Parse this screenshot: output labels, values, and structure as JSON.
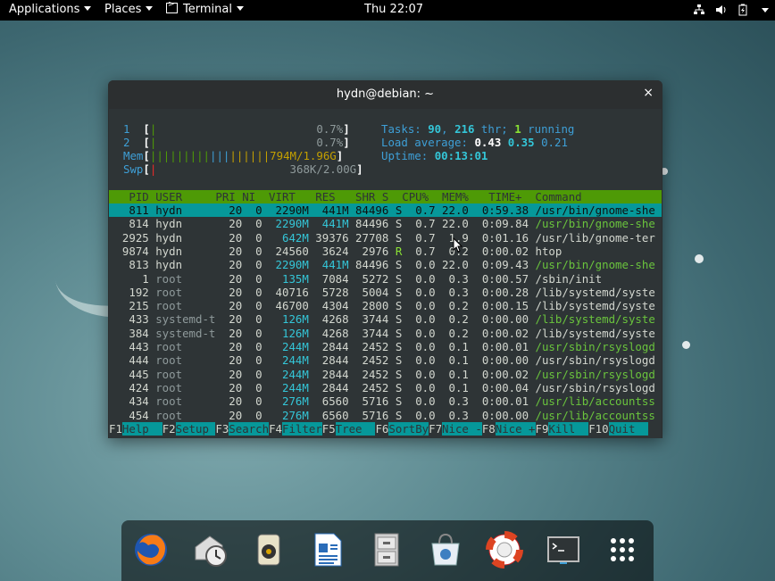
{
  "topbar": {
    "applications": "Applications",
    "places": "Places",
    "terminal": "Terminal",
    "clock": "Thu 22:07",
    "icons": [
      "network-icon",
      "volume-icon",
      "battery-icon",
      "power-menu-icon"
    ]
  },
  "window": {
    "title": "hydn@debian: ~",
    "close": "×"
  },
  "htop": {
    "cpu1": {
      "label": "1",
      "percent": "0.7%"
    },
    "cpu2": {
      "label": "2",
      "percent": "0.7%"
    },
    "mem": {
      "label": "Mem",
      "value": "794M/1.96G"
    },
    "swp": {
      "label": "Swp",
      "value": "368K/2.00G"
    },
    "tasks_label": "Tasks: ",
    "tasks": "90",
    "threads": "216",
    "threads_label": " thr; ",
    "running": "1",
    "running_label": " running",
    "load_label": "Load average: ",
    "load1": "0.43",
    "load5": "0.35",
    "load15": "0.21",
    "uptime_label": "Uptime: ",
    "uptime": "00:13:01",
    "columns": [
      "PID",
      "USER",
      "PRI",
      "NI",
      "VIRT",
      "RES",
      "SHR",
      "S",
      "CPU%",
      "MEM%",
      "TIME+",
      "Command"
    ],
    "processes": [
      {
        "pid": "811",
        "user": "hydn",
        "pri": "20",
        "ni": "0",
        "virt": "2290M",
        "res": "441M",
        "shr": "84496",
        "s": "S",
        "cpu": "0.7",
        "mem": "22.0",
        "time": "0:59.38",
        "cmd": "/usr/bin/gnome-she"
      },
      {
        "pid": "814",
        "user": "hydn",
        "pri": "20",
        "ni": "0",
        "virt": "2290M",
        "res": "441M",
        "shr": "84496",
        "s": "S",
        "cpu": "0.7",
        "mem": "22.0",
        "time": "0:09.84",
        "cmd": "/usr/bin/gnome-she"
      },
      {
        "pid": "2925",
        "user": "hydn",
        "pri": "20",
        "ni": "0",
        "virt": "642M",
        "res": "39376",
        "shr": "27708",
        "s": "S",
        "cpu": "0.7",
        "mem": "1.9",
        "time": "0:01.16",
        "cmd": "/usr/lib/gnome-ter"
      },
      {
        "pid": "9874",
        "user": "hydn",
        "pri": "20",
        "ni": "0",
        "virt": "24560",
        "res": "3624",
        "shr": "2976",
        "s": "R",
        "cpu": "0.7",
        "mem": "0.2",
        "time": "0:00.02",
        "cmd": "htop"
      },
      {
        "pid": "813",
        "user": "hydn",
        "pri": "20",
        "ni": "0",
        "virt": "2290M",
        "res": "441M",
        "shr": "84496",
        "s": "S",
        "cpu": "0.0",
        "mem": "22.0",
        "time": "0:09.43",
        "cmd": "/usr/bin/gnome-she"
      },
      {
        "pid": "1",
        "user": "root",
        "pri": "20",
        "ni": "0",
        "virt": "135M",
        "res": "7084",
        "shr": "5272",
        "s": "S",
        "cpu": "0.0",
        "mem": "0.3",
        "time": "0:00.57",
        "cmd": "/sbin/init"
      },
      {
        "pid": "192",
        "user": "root",
        "pri": "20",
        "ni": "0",
        "virt": "40716",
        "res": "5728",
        "shr": "5004",
        "s": "S",
        "cpu": "0.0",
        "mem": "0.3",
        "time": "0:00.28",
        "cmd": "/lib/systemd/syste"
      },
      {
        "pid": "215",
        "user": "root",
        "pri": "20",
        "ni": "0",
        "virt": "46700",
        "res": "4304",
        "shr": "2800",
        "s": "S",
        "cpu": "0.0",
        "mem": "0.2",
        "time": "0:00.15",
        "cmd": "/lib/systemd/syste"
      },
      {
        "pid": "433",
        "user": "systemd-t",
        "pri": "20",
        "ni": "0",
        "virt": "126M",
        "res": "4268",
        "shr": "3744",
        "s": "S",
        "cpu": "0.0",
        "mem": "0.2",
        "time": "0:00.00",
        "cmd": "/lib/systemd/syste"
      },
      {
        "pid": "384",
        "user": "systemd-t",
        "pri": "20",
        "ni": "0",
        "virt": "126M",
        "res": "4268",
        "shr": "3744",
        "s": "S",
        "cpu": "0.0",
        "mem": "0.2",
        "time": "0:00.02",
        "cmd": "/lib/systemd/syste"
      },
      {
        "pid": "443",
        "user": "root",
        "pri": "20",
        "ni": "0",
        "virt": "244M",
        "res": "2844",
        "shr": "2452",
        "s": "S",
        "cpu": "0.0",
        "mem": "0.1",
        "time": "0:00.01",
        "cmd": "/usr/sbin/rsyslogd"
      },
      {
        "pid": "444",
        "user": "root",
        "pri": "20",
        "ni": "0",
        "virt": "244M",
        "res": "2844",
        "shr": "2452",
        "s": "S",
        "cpu": "0.0",
        "mem": "0.1",
        "time": "0:00.00",
        "cmd": "/usr/sbin/rsyslogd"
      },
      {
        "pid": "445",
        "user": "root",
        "pri": "20",
        "ni": "0",
        "virt": "244M",
        "res": "2844",
        "shr": "2452",
        "s": "S",
        "cpu": "0.0",
        "mem": "0.1",
        "time": "0:00.02",
        "cmd": "/usr/sbin/rsyslogd"
      },
      {
        "pid": "424",
        "user": "root",
        "pri": "20",
        "ni": "0",
        "virt": "244M",
        "res": "2844",
        "shr": "2452",
        "s": "S",
        "cpu": "0.0",
        "mem": "0.1",
        "time": "0:00.04",
        "cmd": "/usr/sbin/rsyslogd"
      },
      {
        "pid": "434",
        "user": "root",
        "pri": "20",
        "ni": "0",
        "virt": "276M",
        "res": "6560",
        "shr": "5716",
        "s": "S",
        "cpu": "0.0",
        "mem": "0.3",
        "time": "0:00.01",
        "cmd": "/usr/lib/accountss"
      },
      {
        "pid": "454",
        "user": "root",
        "pri": "20",
        "ni": "0",
        "virt": "276M",
        "res": "6560",
        "shr": "5716",
        "s": "S",
        "cpu": "0.0",
        "mem": "0.3",
        "time": "0:00.00",
        "cmd": "/usr/lib/accountss"
      }
    ],
    "fkeys": [
      {
        "key": "F1",
        "label": "Help  "
      },
      {
        "key": "F2",
        "label": "Setup "
      },
      {
        "key": "F3",
        "label": "Search"
      },
      {
        "key": "F4",
        "label": "Filter"
      },
      {
        "key": "F5",
        "label": "Tree  "
      },
      {
        "key": "F6",
        "label": "SortBy"
      },
      {
        "key": "F7",
        "label": "Nice -"
      },
      {
        "key": "F8",
        "label": "Nice +"
      },
      {
        "key": "F9",
        "label": "Kill  "
      },
      {
        "key": "F10",
        "label": "Quit  "
      }
    ]
  },
  "dock": {
    "apps": [
      "firefox-icon",
      "evolution-icon",
      "rhythmbox-icon",
      "libreoffice-writer-icon",
      "file-cabinet-icon",
      "software-center-icon",
      "help-icon",
      "terminal-icon",
      "app-grid-icon"
    ]
  },
  "colors": {
    "accent": "#3e9fd6",
    "header_bg": "#4e9a06",
    "selection_bg": "#06989a",
    "terminal_bg": "#2e3436"
  }
}
